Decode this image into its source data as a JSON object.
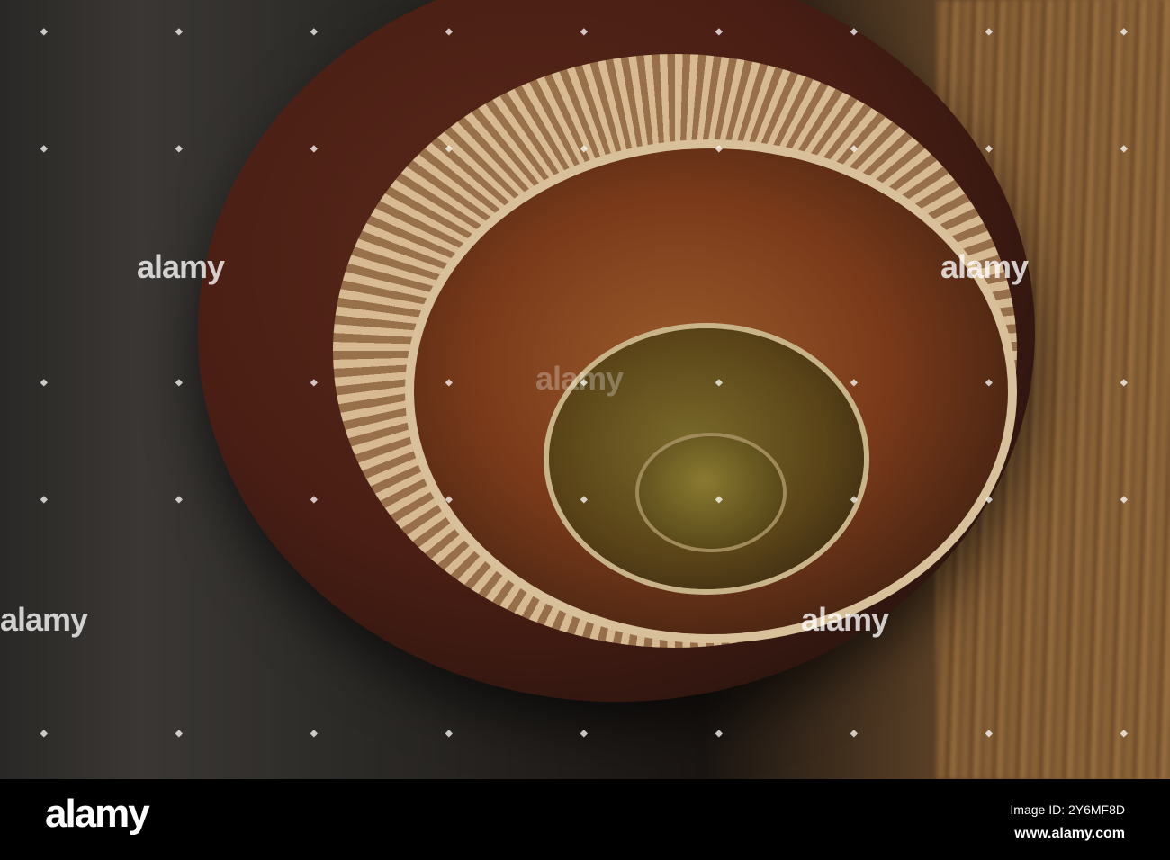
{
  "watermark": {
    "text": "alamy"
  },
  "footer": {
    "logo": "alamy",
    "image_id": "Image ID: 2Y6MF8D",
    "site": "www.alamy.com"
  }
}
